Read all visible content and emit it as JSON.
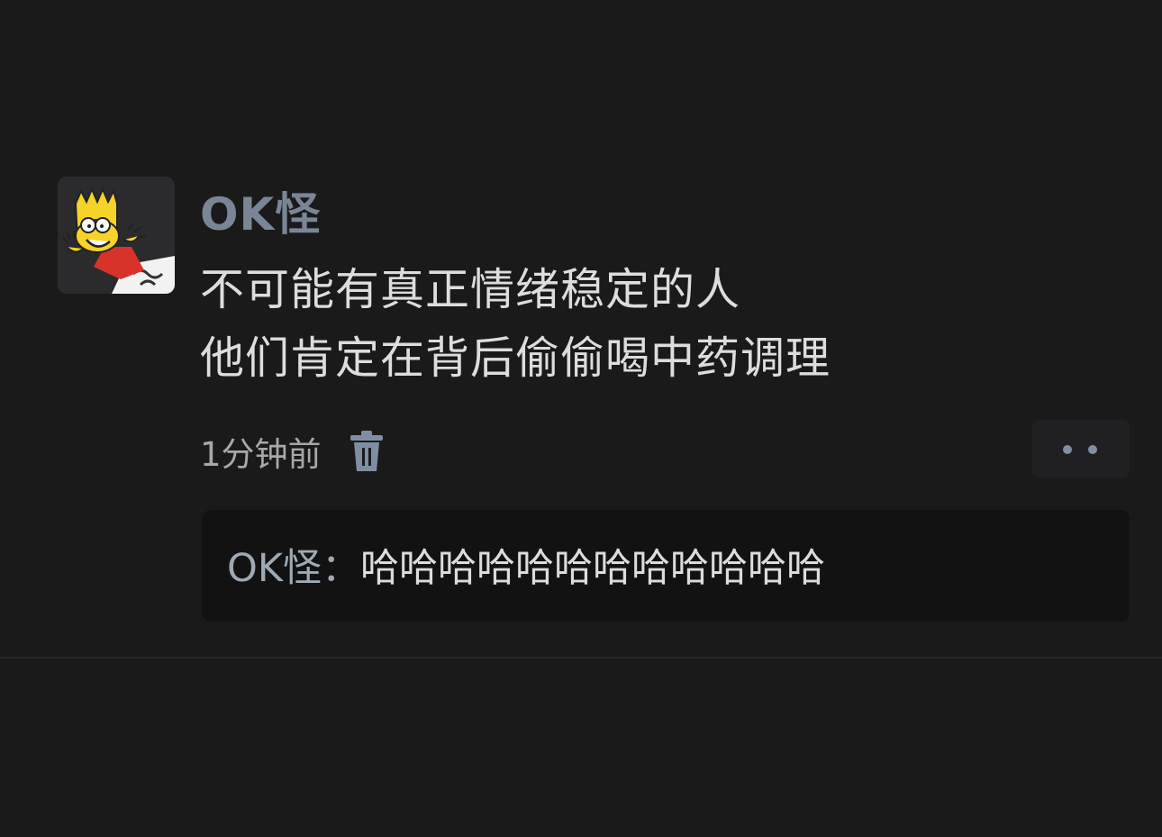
{
  "post": {
    "username": "OK怪",
    "content_lines": [
      "不可能有真正情绪稳定的人",
      "他们肯定在背后偷偷喝中药调理"
    ],
    "timestamp": "1分钟前",
    "delete_icon": "trash-icon",
    "more_icon": "more-dots-icon"
  },
  "reply": {
    "author": "OK怪",
    "separator": "：",
    "text": "哈哈哈哈哈哈哈哈哈哈哈哈"
  },
  "colors": {
    "background": "#1a1a1b",
    "username": "#7a8596",
    "accent_icon": "#7f8ea3",
    "reply_box": "#121213"
  }
}
